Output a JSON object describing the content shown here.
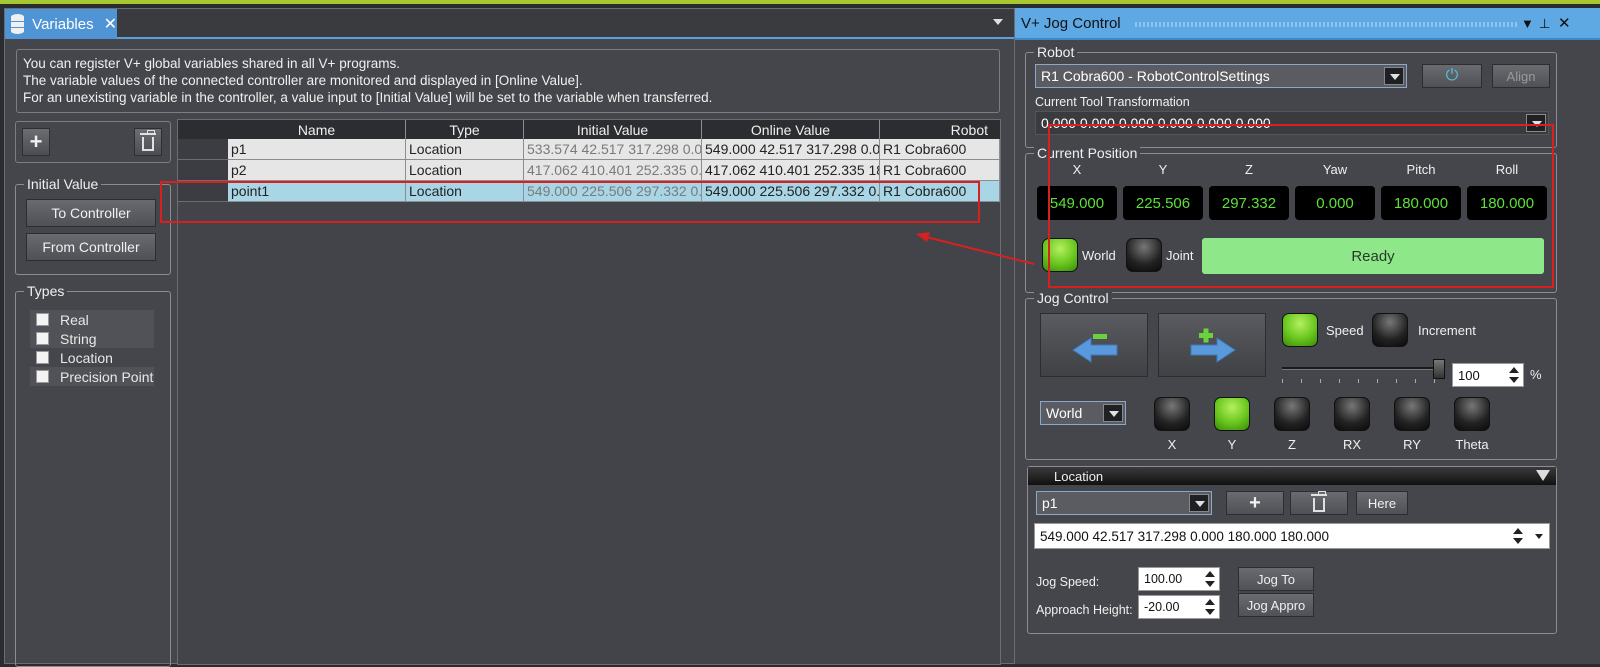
{
  "variables": {
    "tab_title": "Variables",
    "info_lines": [
      "You can register V+ global variables shared in all V+ programs.",
      "The variable values of the connected controller are monitored and displayed in [Online Value].",
      "For an unexisting variable in the controller, a value input to [Initial Value] will be set to the variable when transferred."
    ],
    "initial_value": {
      "label": "Initial Value",
      "to_controller": "To Controller",
      "from_controller": "From Controller"
    },
    "types": {
      "label": "Types",
      "items": [
        "Real",
        "String",
        "Location",
        "Precision Point"
      ]
    },
    "grid": {
      "columns": [
        "Name",
        "Type",
        "Initial Value",
        "Online Value",
        "Robot"
      ],
      "rows": [
        {
          "name": "p1",
          "type": "Location",
          "initial": "533.574 42.517 317.298 0.0",
          "online": "549.000 42.517 317.298 0.0",
          "robot": "R1 Cobra600"
        },
        {
          "name": "p2",
          "type": "Location",
          "initial": "417.062 410.401 252.335 0.",
          "online": "417.062 410.401 252.335 18",
          "robot": "R1 Cobra600"
        },
        {
          "name": "point1",
          "type": "Location",
          "initial": "549.000 225.506 297.332 0.",
          "online": "549.000 225.506 297.332 0.",
          "robot": "R1 Cobra600"
        }
      ]
    }
  },
  "jog": {
    "title": "V+ Jog Control",
    "robot": {
      "label": "Robot",
      "selected": "R1 Cobra600  -  RobotControlSettings",
      "align": "Align"
    },
    "tool": {
      "label": "Current Tool Transformation",
      "value": "0.000 0.000 0.000 0.000 0.000 0.000"
    },
    "position": {
      "label": "Current Position",
      "axes": [
        "X",
        "Y",
        "Z",
        "Yaw",
        "Pitch",
        "Roll"
      ],
      "values": [
        "549.000",
        "225.506",
        "297.332",
        "0.000",
        "180.000",
        "180.000"
      ],
      "world": "World",
      "joint": "Joint",
      "status": "Ready"
    },
    "control": {
      "label": "Jog Control",
      "speed": "Speed",
      "increment": "Increment",
      "percent_value": "100",
      "percent_unit": "%",
      "speed_fraction": 1.0,
      "frame": "World",
      "axes": [
        "X",
        "Y",
        "Z",
        "RX",
        "RY",
        "Theta"
      ],
      "active_axis": "Y"
    },
    "location": {
      "label": "Location",
      "selected": "p1",
      "here": "Here",
      "value": "549.000 42.517 317.298 0.000 180.000 180.000",
      "jog_speed_label": "Jog Speed:",
      "jog_speed": "100.00",
      "approach_label": "Approach Height:",
      "approach": "-20.00",
      "jog_to": "Jog To",
      "jog_appro": "Jog Appro"
    }
  },
  "colors": {
    "accent_blue": "#5ea8e4",
    "status_green": "#8ee88a",
    "readout_green": "#5ee03a",
    "highlight_red": "#d82020"
  }
}
